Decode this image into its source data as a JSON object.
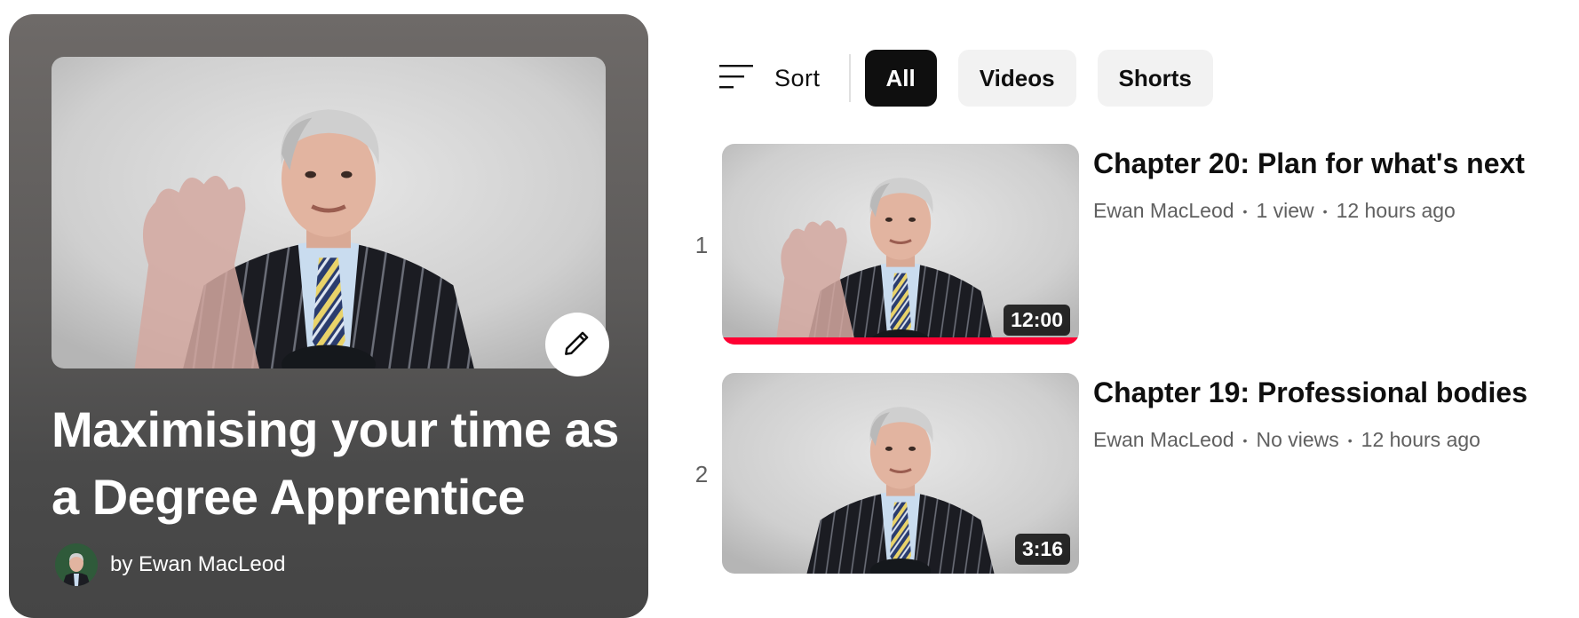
{
  "playlist": {
    "title": "Maximising your time as a Degree Apprentice",
    "owner": "by Ewan MacLeod",
    "edit_icon": "pencil-icon"
  },
  "filters": {
    "sort_label": "Sort",
    "sort_icon": "sort-icon",
    "chips": [
      {
        "label": "All",
        "active": true
      },
      {
        "label": "Videos",
        "active": false
      },
      {
        "label": "Shorts",
        "active": false
      }
    ]
  },
  "videos": [
    {
      "index": "1",
      "title": "Chapter 20: Plan for what's next",
      "channel": "Ewan MacLeod",
      "views": "1 view",
      "age": "12 hours ago",
      "duration": "12:00",
      "watched_fraction": 1.0
    },
    {
      "index": "2",
      "title": "Chapter 19: Professional bodies",
      "channel": "Ewan MacLeod",
      "views": "No views",
      "age": "12 hours ago",
      "duration": "3:16",
      "watched_fraction": 0
    }
  ],
  "colors": {
    "progress": "#ff0033",
    "chip_active_bg": "#0f0f0f",
    "chip_bg": "#f2f2f2",
    "panel_bg": "#5d5b5a"
  }
}
